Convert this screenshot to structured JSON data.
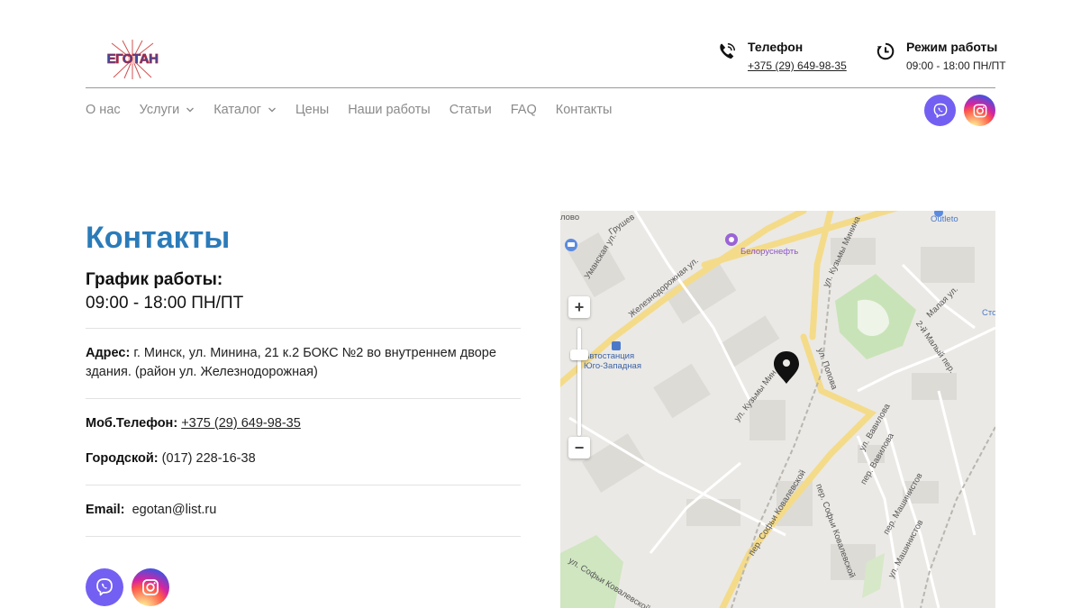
{
  "header": {
    "logo_text": "ЕГОТАН",
    "phone": {
      "title": "Телефон",
      "value": "+375 (29) 649-98-35",
      "icon": "phone-icon"
    },
    "hours": {
      "title": "Режим работы",
      "value": "09:00 - 18:00 ПН/ПТ",
      "icon": "clock-icon"
    }
  },
  "nav": [
    {
      "label": "О нас"
    },
    {
      "label": "Услуги",
      "dropdown": true
    },
    {
      "label": "Каталог",
      "dropdown": true
    },
    {
      "label": "Цены"
    },
    {
      "label": "Наши работы"
    },
    {
      "label": "Статьи"
    },
    {
      "label": "FAQ"
    },
    {
      "label": "Контакты"
    }
  ],
  "social": {
    "viber": "viber-icon",
    "instagram": "instagram-icon"
  },
  "page": {
    "title": "Контакты",
    "schedule_title": "График работы:",
    "schedule_value": "09:00 - 18:00 ПН/ПТ",
    "address_label": "Адрес:",
    "address_value": "г. Минск, ул. Минина, 21 к.2 БОКС №2 во внутреннем дворе здания. (район ул. Железнодорожная)",
    "mobile_label": "Моб.Телефон:",
    "mobile_value": "+375 (29) 649-98-35",
    "city_label": "Городской:",
    "city_value": "(017) 228-16-38",
    "email_label": "Email:",
    "email_value": "egotan@list.ru"
  },
  "map": {
    "zoom_in": "+",
    "zoom_out": "−",
    "labels": {
      "l1": "лово",
      "l2": "Грушев",
      "l3": "Уманская ул.",
      "l4": "Железнодорожная ул.",
      "l5": "Белоруснефть",
      "l6": "ул. Кузьмы Минина",
      "l7": "Outleto",
      "l8": "Малая ул.",
      "l9": "Сто",
      "l10": "2-й Малый пер.",
      "l11": "Автостанция",
      "l12": "Юго-Западная",
      "l13": "ул. Кузьмы Мин",
      "l14": "ул. Попова",
      "l15": "ул. Вавилова",
      "l16": "пер. Вавилова",
      "l17": "ул. Вавилова",
      "l18": "пер. Машинистов",
      "l19": "ул. Машинистов",
      "l20": "пер. Софьи Ковалевской",
      "l21": "пер. Софьи Ковалевской",
      "l22": "ул. Софьи Ковалевской"
    }
  },
  "colors": {
    "accent": "#2b7bb9",
    "viber": "#7360f2",
    "nav_text": "#8a8a8a"
  }
}
